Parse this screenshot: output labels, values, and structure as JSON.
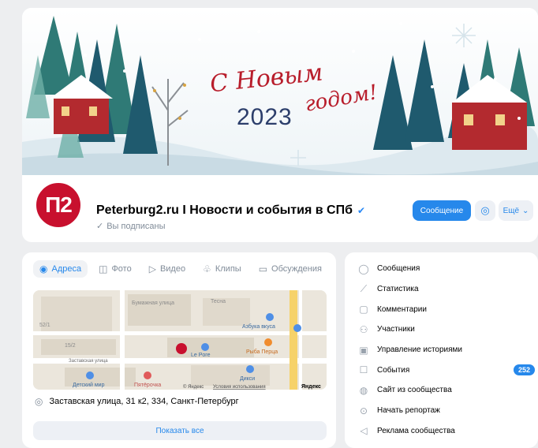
{
  "cover": {
    "greeting_line1": "С Новым",
    "greeting_line2": "годом!",
    "year": "2023"
  },
  "group": {
    "avatar_text": "П2",
    "name": "Peterburg2.ru I Новости и события в СПб",
    "verified_icon": "verified-check-icon",
    "status": "Вы подписаны",
    "message_button": "Сообщение",
    "more_button": "Ещё"
  },
  "tabs": [
    {
      "label": "Адреса",
      "icon": "pin-icon",
      "active": true
    },
    {
      "label": "Фото",
      "icon": "camera-icon",
      "active": false
    },
    {
      "label": "Видео",
      "icon": "video-icon",
      "active": false
    },
    {
      "label": "Клипы",
      "icon": "clips-icon",
      "active": false
    },
    {
      "label": "Обсуждения",
      "icon": "chat-icon",
      "active": false
    }
  ],
  "map": {
    "labels": {
      "street_top": "Бумажная улица",
      "street_top2": "Тесна",
      "house_1": "52/1",
      "house_2": "15/2",
      "street_mid": "Заставская улица",
      "poi_1": "Азбука вкуса",
      "poi_2": "Le Pore",
      "poi_3": "Рыба Перца",
      "poi_4": "Детский мир",
      "poi_5": "Пятёрочка",
      "poi_6": "Дикси",
      "footer_1": "© Яндекс",
      "footer_2": "Условия использования",
      "logo": "Яндекс"
    }
  },
  "address": "Заставская улица, 31 к2, 334, Санкт-Петербург",
  "show_all": "Показать все",
  "menu": [
    {
      "label": "Сообщения",
      "icon": "message-icon"
    },
    {
      "label": "Статистика",
      "icon": "stats-icon"
    },
    {
      "label": "Комментарии",
      "icon": "comment-icon"
    },
    {
      "label": "Участники",
      "icon": "users-icon"
    },
    {
      "label": "Управление историями",
      "icon": "stories-icon"
    },
    {
      "label": "События",
      "icon": "calendar-icon",
      "badge": "252"
    },
    {
      "label": "Сайт из сообщества",
      "icon": "globe-icon"
    },
    {
      "label": "Начать репортаж",
      "icon": "broadcast-icon"
    },
    {
      "label": "Реклама сообщества",
      "icon": "ads-icon"
    }
  ],
  "colors": {
    "accent": "#2688eb",
    "brand": "#c8102e",
    "background": "#edeef0"
  }
}
